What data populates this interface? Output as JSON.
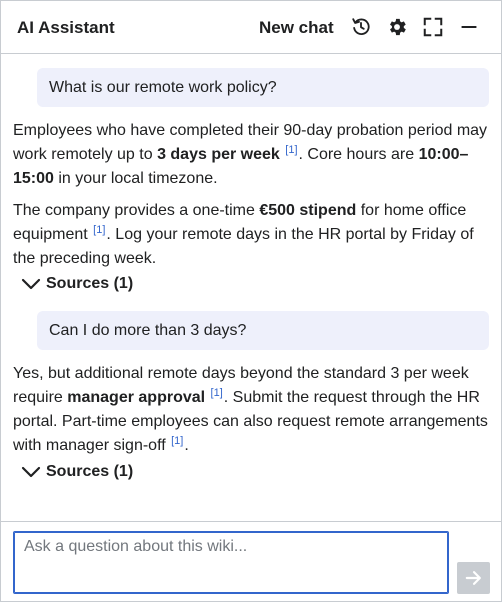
{
  "header": {
    "title": "AI Assistant",
    "new_chat_label": "New chat",
    "icons": [
      "history-icon",
      "gear-icon",
      "expand-icon",
      "minimize-icon"
    ]
  },
  "messages": [
    {
      "role": "user",
      "text": "What is our remote work policy?"
    },
    {
      "role": "assistant",
      "paragraphs": [
        {
          "t1": "Employees who have completed their 90-day probation period may work remotely up to ",
          "b1": "3 days per week",
          "c1": "[1]",
          "t2": ". Core hours are ",
          "b2": "10:00–15:00",
          "t3": " in your local timezone."
        },
        {
          "t1": "The company provides a one-time ",
          "b1": "€500 stipend",
          "t2": " for home office equipment ",
          "c1": "[1]",
          "t3": ". Log your remote days in the HR portal by Friday of the preceding week."
        }
      ],
      "sources_label": "Sources (1)"
    },
    {
      "role": "user",
      "text": "Can I do more than 3 days?"
    },
    {
      "role": "assistant",
      "paragraphs": [
        {
          "t1": "Yes, but additional remote days beyond the standard 3 per week require ",
          "b1": "manager approval",
          "c1": "[1]",
          "t2": ". Submit the request through the HR portal. Part-time employees can also request remote arrangements with manager sign-off ",
          "c2": "[1]",
          "t3": "."
        }
      ],
      "sources_label": "Sources (1)"
    }
  ],
  "composer": {
    "placeholder": "Ask a question about this wiki...",
    "value": "",
    "send_icon": "arrow-right-icon"
  },
  "colors": {
    "accent": "#3366cc",
    "user_bubble": "#eef0fb",
    "border": "#c8ccd1",
    "send_disabled": "#c8ccd1"
  }
}
